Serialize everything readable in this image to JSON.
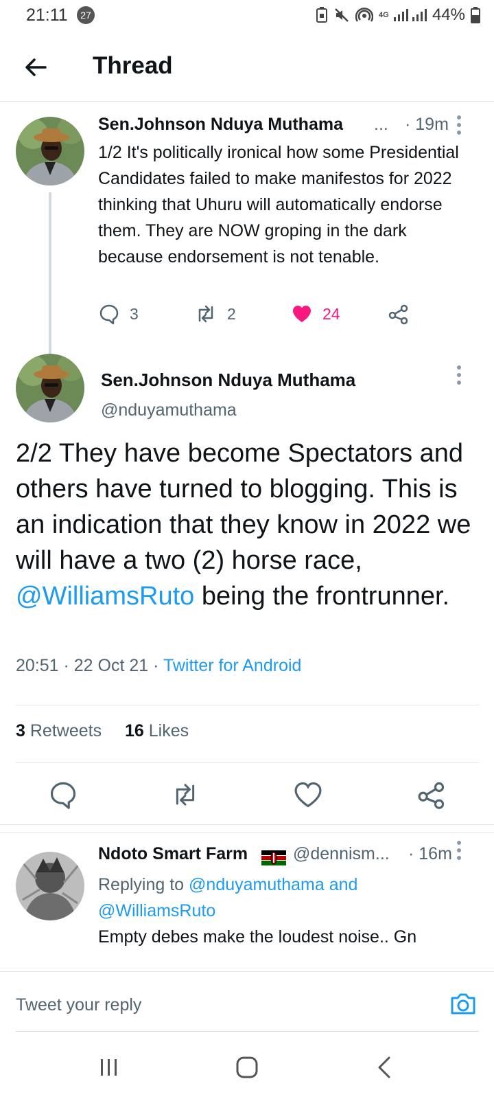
{
  "status_bar": {
    "time": "21:11",
    "notification_count": "27",
    "network": "4G",
    "battery": "44%"
  },
  "header": {
    "title": "Thread",
    "back_icon": "arrow-left-icon"
  },
  "tweet1": {
    "author_name": "Sen.Johnson Nduya Muthama",
    "ellipsis": "...",
    "time": "· 19m",
    "text": "1/2 It's politically ironical how some Presidential Candidates failed to make manifestos for 2022 thinking that Uhuru will automatically endorse them. They are NOW groping in the dark because endorsement is not tenable.",
    "replies": "3",
    "retweets": "2",
    "likes": "24",
    "liked": true
  },
  "tweet2": {
    "author_name": "Sen.Johnson Nduya Muthama",
    "handle": "@nduyamuthama",
    "text_part1": "2/2 They have become Spectators and others have turned to blogging. This is an indication that they know in 2022 we will have a two (2) horse race, ",
    "mention": "@WilliamsRuto",
    "text_part2": " being the frontrunner.",
    "timestamp": "20:51 · 22 Oct 21 · ",
    "source": "Twitter for Android",
    "retweet_count": "3",
    "retweet_label": "Retweets",
    "like_count": "16",
    "like_label": "Likes"
  },
  "reply": {
    "author_name": "Ndoto Smart Farm",
    "handle": "@dennism...",
    "time": "· 16m",
    "replying_prefix": "Replying to ",
    "replying_to_1": "@nduyamuthama",
    "replying_and": " and",
    "replying_to_2": "@WilliamsRuto",
    "text": "Empty debes make the loudest noise.. Gn"
  },
  "compose": {
    "placeholder": "Tweet your reply"
  },
  "colors": {
    "accent": "#1d9bf0",
    "like": "#f91880",
    "text_primary": "#0f1419",
    "text_secondary": "#536471",
    "divider": "#e1e6ea"
  }
}
